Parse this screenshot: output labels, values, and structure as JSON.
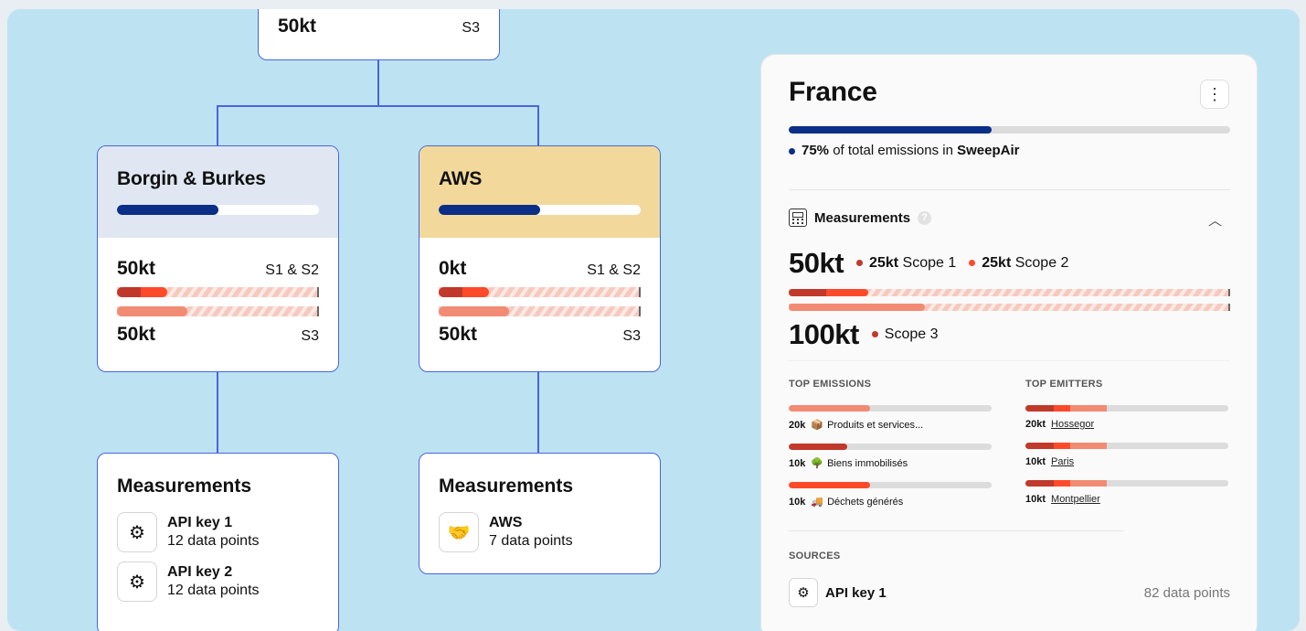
{
  "top_node": {
    "value": "50kt",
    "scope": "S3"
  },
  "nodes": [
    {
      "title": "Borgin & Burkes",
      "header_color": "#e0e7f3",
      "share_pct": 50,
      "s12_value": "50kt",
      "s12_label": "S1 & S2",
      "s3_value": "50kt",
      "s3_label": "S3",
      "s1_pct": 12,
      "s2_pct": 13,
      "s3_pct": 35
    },
    {
      "title": "AWS",
      "header_color": "#f2d99b",
      "share_pct": 50,
      "s12_value": "0kt",
      "s12_label": "S1 & S2",
      "s3_value": "50kt",
      "s3_label": "S3",
      "s1_pct": 12,
      "s2_pct": 13,
      "s3_pct": 35
    }
  ],
  "measurements_nodes": [
    {
      "title": "Measurements",
      "sources": [
        {
          "icon": "⚙",
          "name": "API key 1",
          "sub": "12 data points"
        },
        {
          "icon": "⚙",
          "name": "API key 2",
          "sub": "12 data points"
        }
      ]
    },
    {
      "title": "Measurements",
      "sources": [
        {
          "icon": "🤝",
          "name": "AWS",
          "sub": "7 data points"
        }
      ]
    }
  ],
  "panel": {
    "title": "France",
    "menu_icon": "⋮",
    "share_pct": 46,
    "share_value": "75%",
    "share_mid": "of total emissions in",
    "share_org": "SweepAir",
    "measurements_label": "Measurements",
    "help_icon": "?",
    "chevron": "︿",
    "s12_total": "50kt",
    "scope1_value": "25kt",
    "scope1_label": "Scope 1",
    "scope2_value": "25kt",
    "scope2_label": "Scope 2",
    "s3_total": "100kt",
    "scope3_label": "Scope 3",
    "top_emissions_label": "TOP EMISSIONS",
    "top_emitters_label": "TOP EMITTERS",
    "top_emissions": [
      {
        "value": "20k",
        "emoji": "📦",
        "label": "Produits et services...",
        "pct": 40,
        "color": "#f28b73"
      },
      {
        "value": "10k",
        "emoji": "🌳",
        "label": "Biens immobilisés",
        "pct": 29,
        "color": "#c0392b"
      },
      {
        "value": "10k",
        "emoji": "🚚",
        "label": "Déchets générés",
        "pct": 40,
        "color": "#ff4a2a"
      }
    ],
    "top_emitters": [
      {
        "value": "20kt",
        "label": "Hossegor",
        "pct": 40
      },
      {
        "value": "10kt",
        "label": "Paris",
        "pct": 40
      },
      {
        "value": "10kt",
        "label": "Montpellier",
        "pct": 40
      }
    ],
    "sources_label": "SOURCES",
    "source": {
      "icon": "⚙",
      "name": "API key 1",
      "count": "82 data points"
    }
  },
  "colors": {
    "accent": "#4a63e0",
    "navy": "#0b2e86",
    "scope1": "#c0392b",
    "scope2": "#ff4a2a",
    "scope3": "#f28b73"
  }
}
